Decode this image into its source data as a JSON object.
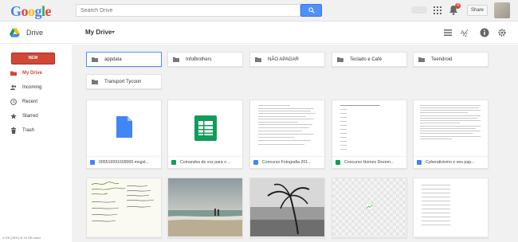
{
  "header": {
    "logo": "Google",
    "search_placeholder": "Search Drive",
    "notification_count": "4",
    "share_label": "Share",
    "icons": [
      "search-icon",
      "apps-grid-icon",
      "bell-icon"
    ]
  },
  "subheader": {
    "app_label": "Drive",
    "location_title": "My Drive",
    "icons": [
      "list-view-icon",
      "sort-az-icon",
      "info-icon",
      "settings-icon"
    ]
  },
  "sidebar": {
    "new_label": "NEW",
    "items": [
      {
        "label": "My Drive",
        "icon": "drive-folder-icon",
        "active": true
      },
      {
        "label": "Incoming",
        "icon": "people-icon",
        "active": false
      },
      {
        "label": "Recent",
        "icon": "clock-icon",
        "active": false
      },
      {
        "label": "Starred",
        "icon": "star-icon",
        "active": false
      },
      {
        "label": "Trash",
        "icon": "trash-icon",
        "active": false
      }
    ],
    "storage_text": "4 GB (26%) of 15 GB used"
  },
  "folders": [
    {
      "name": "appdata"
    },
    {
      "name": "InfoBrothers"
    },
    {
      "name": "NÃO APAGAR"
    },
    {
      "name": "Teclado e Café"
    },
    {
      "name": "Teendroid"
    },
    {
      "name": "Transport Tycoon"
    }
  ],
  "files_row1": [
    {
      "name": "005516991609000.msgst...",
      "type_icon": "doc-icon"
    },
    {
      "name": "Comandos de voz para o ...",
      "type_icon": "sheets-icon"
    },
    {
      "name": "Concurso Fotografia 201...",
      "type_icon": "doc-icon"
    },
    {
      "name": "Concurso Homes Dezem...",
      "type_icon": "sheets-icon"
    },
    {
      "name": "Cyberativismo e seu pap...",
      "type_icon": "doc-icon"
    }
  ],
  "colors": {
    "accent_red": "#d14836",
    "search_blue": "#4d90fe",
    "doc_blue": "#4285f4",
    "sheets_green": "#0f9d58",
    "background_gray": "#f1f1f1"
  }
}
